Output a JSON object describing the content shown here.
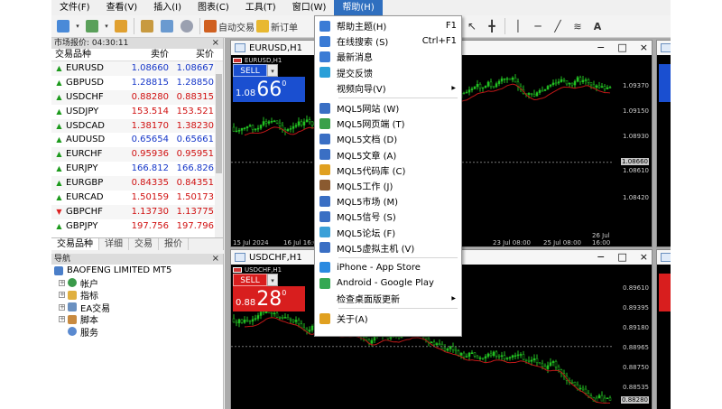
{
  "menubar": {
    "items": [
      "文件(F)",
      "查看(V)",
      "插入(I)",
      "图表(C)",
      "工具(T)",
      "窗口(W)",
      "帮助(H)"
    ],
    "active_index": 6
  },
  "toolbar": {
    "auto_trading": "自动交易",
    "new_order": "新订单"
  },
  "market_watch": {
    "title": "市场报价: 04:30:11",
    "col_symbol": "交易品种",
    "col_bid": "卖价",
    "col_ask": "买价",
    "rows": [
      {
        "symbol": "EURUSD",
        "bid": "1.08660",
        "ask": "1.08667",
        "dir": "up",
        "color": "blue"
      },
      {
        "symbol": "GBPUSD",
        "bid": "1.28815",
        "ask": "1.28850",
        "dir": "up",
        "color": "blue"
      },
      {
        "symbol": "USDCHF",
        "bid": "0.88280",
        "ask": "0.88315",
        "dir": "up",
        "color": "red"
      },
      {
        "symbol": "USDJPY",
        "bid": "153.514",
        "ask": "153.521",
        "dir": "up",
        "color": "red"
      },
      {
        "symbol": "USDCAD",
        "bid": "1.38170",
        "ask": "1.38230",
        "dir": "up",
        "color": "red"
      },
      {
        "symbol": "AUDUSD",
        "bid": "0.65654",
        "ask": "0.65661",
        "dir": "up",
        "color": "blue"
      },
      {
        "symbol": "EURCHF",
        "bid": "0.95936",
        "ask": "0.95951",
        "dir": "up",
        "color": "red"
      },
      {
        "symbol": "EURJPY",
        "bid": "166.812",
        "ask": "166.826",
        "dir": "up",
        "color": "blue"
      },
      {
        "symbol": "EURGBP",
        "bid": "0.84335",
        "ask": "0.84351",
        "dir": "up",
        "color": "red"
      },
      {
        "symbol": "EURCAD",
        "bid": "1.50159",
        "ask": "1.50173",
        "dir": "up",
        "color": "red"
      },
      {
        "symbol": "GBPCHF",
        "bid": "1.13730",
        "ask": "1.13775",
        "dir": "dn",
        "color": "red"
      },
      {
        "symbol": "GBPJPY",
        "bid": "197.756",
        "ask": "197.796",
        "dir": "up",
        "color": "red"
      }
    ],
    "tabs": [
      "交易品种",
      "详细",
      "交易",
      "报价"
    ]
  },
  "navigator": {
    "title": "导航",
    "root": "BAOFENG LIMITED MT5",
    "items": [
      "帐户",
      "指标",
      "EA交易",
      "脚本",
      "服务"
    ]
  },
  "chart_eurusd": {
    "title": "EURUSD,H1",
    "symbol_label": "EURUSD,H1",
    "sell_label": "SELL",
    "price_small": "1.08",
    "price_big": "66",
    "price_sup": "0",
    "prices": [
      "1.09370",
      "1.09150",
      "1.08930",
      "1.08660",
      "1.08610",
      "1.08420"
    ],
    "current_price": "1.08660",
    "times": [
      "15 Jul 2024",
      "16 Jul 16:00",
      "23 Jul 08:00",
      "25 Jul 08:00",
      "26 Jul 16:00"
    ]
  },
  "chart_usdchf": {
    "title": "USDCHF,H1",
    "symbol_label": "USDCHF,H1",
    "sell_label": "SELL",
    "price_small": "0.88",
    "price_big": "28",
    "price_sup": "0",
    "prices": [
      "0.89610",
      "0.89395",
      "0.89180",
      "0.88965",
      "0.88750",
      "0.88535",
      "0.88280"
    ],
    "current_price": "0.88280"
  },
  "help_menu": {
    "items": [
      {
        "label": "帮助主题(H)",
        "shortcut": "F1",
        "icon": "help-icon",
        "color": "#3a7bd5"
      },
      {
        "label": "在线搜索 (S)",
        "shortcut": "Ctrl+F1",
        "icon": "search-icon",
        "color": "#3a7bd5"
      },
      {
        "label": "最新消息",
        "shortcut": "",
        "icon": "news-icon",
        "color": "#3a7bd5"
      },
      {
        "label": "提交反馈",
        "shortcut": "",
        "icon": "feedback-icon",
        "color": "#2a9fd8"
      },
      {
        "label": "视频向导(V)",
        "shortcut": "",
        "icon": "",
        "color": "",
        "submenu": true
      },
      {
        "label": "MQL5网站 (W)",
        "shortcut": "",
        "icon": "mql5-site-icon",
        "color": "#3a6fc4",
        "sep_before": true
      },
      {
        "label": "MQL5网页端 (T)",
        "shortcut": "",
        "icon": "mql5-web-icon",
        "color": "#3aa04a"
      },
      {
        "label": "MQL5文档 (D)",
        "shortcut": "",
        "icon": "mql5-docs-icon",
        "color": "#3a6fc4"
      },
      {
        "label": "MQL5文章 (A)",
        "shortcut": "",
        "icon": "mql5-articles-icon",
        "color": "#3a6fc4"
      },
      {
        "label": "MQL5代码库 (C)",
        "shortcut": "",
        "icon": "mql5-codebase-icon",
        "color": "#e0a020"
      },
      {
        "label": "MQL5工作 (J)",
        "shortcut": "",
        "icon": "mql5-jobs-icon",
        "color": "#8a5a30"
      },
      {
        "label": "MQL5市场 (M)",
        "shortcut": "",
        "icon": "mql5-market-icon",
        "color": "#3a6fc4"
      },
      {
        "label": "MQL5信号 (S)",
        "shortcut": "",
        "icon": "mql5-signals-icon",
        "color": "#3a6fc4"
      },
      {
        "label": "MQL5论坛 (F)",
        "shortcut": "",
        "icon": "mql5-forum-icon",
        "color": "#3aa0d8"
      },
      {
        "label": "MQL5虚拟主机 (V)",
        "shortcut": "",
        "icon": "mql5-vps-icon",
        "color": "#3a6fc4"
      },
      {
        "label": "iPhone - App Store",
        "shortcut": "",
        "icon": "app-store-icon",
        "color": "#2a8ae0",
        "sep_before": true
      },
      {
        "label": "Android - Google Play",
        "shortcut": "",
        "icon": "google-play-icon",
        "color": "#34a853"
      },
      {
        "label": "检查桌面版更新",
        "shortcut": "",
        "icon": "",
        "color": "",
        "submenu": true
      },
      {
        "label": "关于(A)",
        "shortcut": "",
        "icon": "about-icon",
        "color": "#e0a020",
        "sep_before": true
      }
    ]
  }
}
